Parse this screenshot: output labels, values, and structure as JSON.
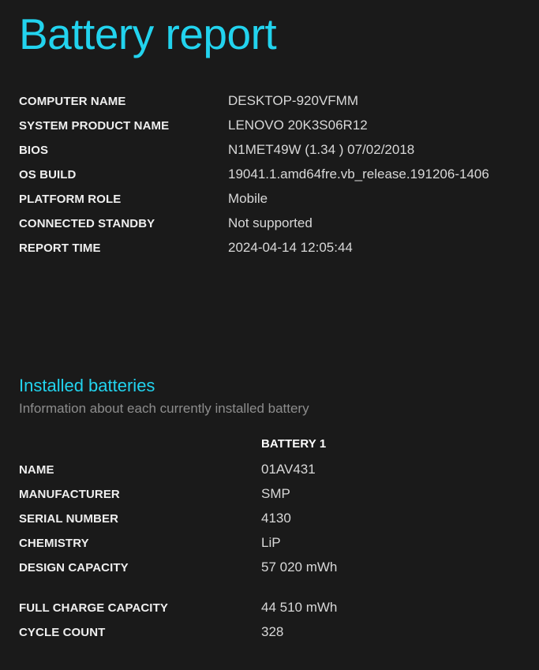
{
  "report": {
    "title": "Battery report"
  },
  "system_info": {
    "rows": [
      {
        "label": "COMPUTER NAME",
        "value": "DESKTOP-920VFMM"
      },
      {
        "label": "SYSTEM PRODUCT NAME",
        "value": "LENOVO 20K3S06R12"
      },
      {
        "label": "BIOS",
        "value": "N1MET49W (1.34 ) 07/02/2018"
      },
      {
        "label": "OS BUILD",
        "value": "19041.1.amd64fre.vb_release.191206-1406"
      },
      {
        "label": "PLATFORM ROLE",
        "value": "Mobile"
      },
      {
        "label": "CONNECTED STANDBY",
        "value": "Not supported"
      },
      {
        "label": "REPORT TIME",
        "value": "2024-04-14  12:05:44"
      }
    ]
  },
  "installed_batteries": {
    "title": "Installed batteries",
    "subtitle": "Information about each currently installed battery",
    "column_header": "BATTERY 1",
    "rows": [
      {
        "label": "NAME",
        "value": "01AV431"
      },
      {
        "label": "MANUFACTURER",
        "value": "SMP"
      },
      {
        "label": "SERIAL NUMBER",
        "value": "4130"
      },
      {
        "label": "CHEMISTRY",
        "value": "LiP"
      },
      {
        "label": "DESIGN CAPACITY",
        "value": "57 020 mWh"
      },
      {
        "label": "FULL CHARGE CAPACITY",
        "value": "44 510 mWh"
      },
      {
        "label": "CYCLE COUNT",
        "value": "328"
      }
    ]
  },
  "colors": {
    "background": "#1a1a1a",
    "accent": "#22d3ee",
    "label": "#efefef",
    "value": "#d8d8d8",
    "subtitle": "#8d8d8d"
  }
}
